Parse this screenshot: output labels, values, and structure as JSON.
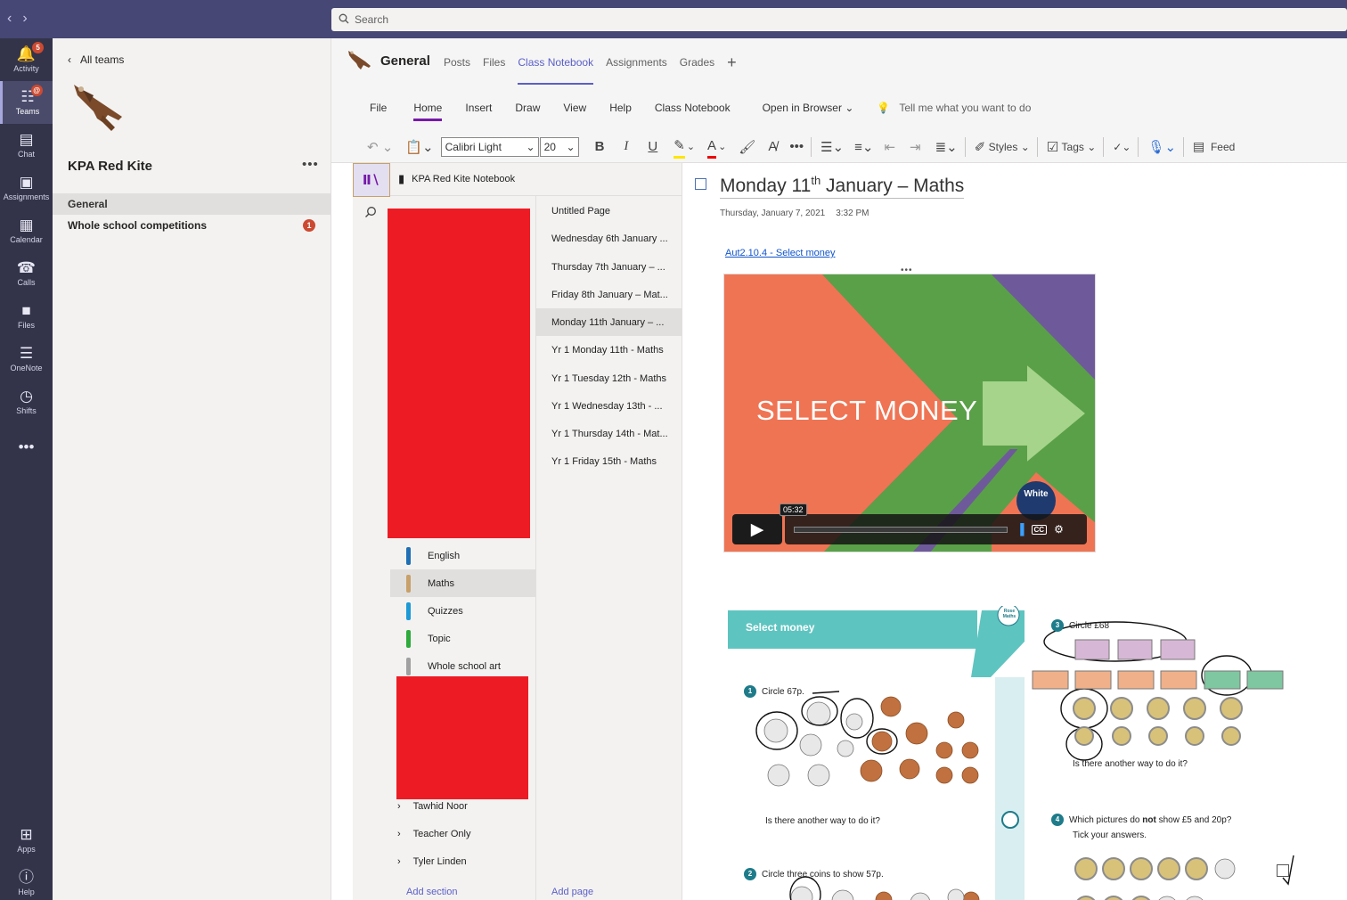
{
  "search": {
    "placeholder": "Search"
  },
  "rail": [
    {
      "name": "Activity",
      "icon": "bell-icon",
      "badge": "5"
    },
    {
      "name": "Teams",
      "icon": "people-icon",
      "badge": "@"
    },
    {
      "name": "Chat",
      "icon": "chat-icon"
    },
    {
      "name": "Assignments",
      "icon": "backpack-icon"
    },
    {
      "name": "Calendar",
      "icon": "calendar-icon"
    },
    {
      "name": "Calls",
      "icon": "phone-icon"
    },
    {
      "name": "Files",
      "icon": "file-icon"
    },
    {
      "name": "OneNote",
      "icon": "onenote-icon"
    },
    {
      "name": "Shifts",
      "icon": "clock-icon"
    },
    {
      "name": "Apps",
      "icon": "apps-icon"
    },
    {
      "name": "Help",
      "icon": "help-icon"
    }
  ],
  "teams": {
    "back_label": "All teams",
    "team_name": "KPA Red Kite",
    "channels": [
      {
        "label": "General"
      },
      {
        "label": "Whole school competitions",
        "badge": "1"
      }
    ]
  },
  "channel": {
    "title": "General",
    "tabs": [
      "Posts",
      "Files",
      "Class Notebook",
      "Assignments",
      "Grades"
    ]
  },
  "ribbon": {
    "tabs": [
      "File",
      "Home",
      "Insert",
      "Draw",
      "View",
      "Help",
      "Class Notebook",
      "Open in Browser"
    ],
    "tell_me": "Tell me what you want to do",
    "font": "Calibri Light",
    "size": "20",
    "styles": "Styles",
    "tags": "Tags",
    "feed": "Feed"
  },
  "notebook": {
    "title": "KPA Red Kite Notebook",
    "sections": [
      {
        "label": "English",
        "color": "#1f6fb5"
      },
      {
        "label": "Maths",
        "color": "#c8a06a"
      },
      {
        "label": "Quizzes",
        "color": "#1c9ad6"
      },
      {
        "label": "Topic",
        "color": "#2dab3c"
      },
      {
        "label": "Whole school art",
        "color": "#a0a0a0"
      }
    ],
    "groups": [
      "Tawhid Noor",
      "Teacher Only",
      "Tyler Linden"
    ],
    "add_section": "Add section",
    "add_page": "Add page"
  },
  "pages": [
    "Untitled Page",
    "Wednesday 6th January ...",
    "Thursday 7th January – ...",
    "Friday 8th January – Mat...",
    "Monday 11th January – ...",
    "Yr 1 Monday 11th - Maths",
    "Yr 1 Tuesday 12th - Maths",
    "Yr 1 Wednesday 13th - ...",
    "Yr 1 Thursday 14th - Mat...",
    "Yr 1 Friday 15th - Maths"
  ],
  "page": {
    "title_pre": "Monday 11",
    "title_sup": "th",
    "title_post": " January – Maths",
    "date": "Thursday, January 7, 2021",
    "time": "3:32 PM",
    "link": "Aut2.10.4 - Select money",
    "video_text": "SELECT MONEY",
    "video_time": "05:32",
    "video_badge": "White",
    "worksheet": {
      "header": "Select money",
      "badge": "Rose Maths",
      "q1": "Circle 67p.",
      "q1_sub": "Is there another way to do it?",
      "q2": "Circle three coins to show 57p.",
      "q3": "Circle £68",
      "q3_sub": "Is there another way to do it?",
      "q4_pre": "Which pictures do ",
      "q4_bold": "not",
      "q4_post": " show £5 and 20p?",
      "q4_sub": "Tick your answers.",
      "q1_num": "1",
      "q2_num": "2",
      "q3_num": "3",
      "q4_num": "4"
    }
  }
}
